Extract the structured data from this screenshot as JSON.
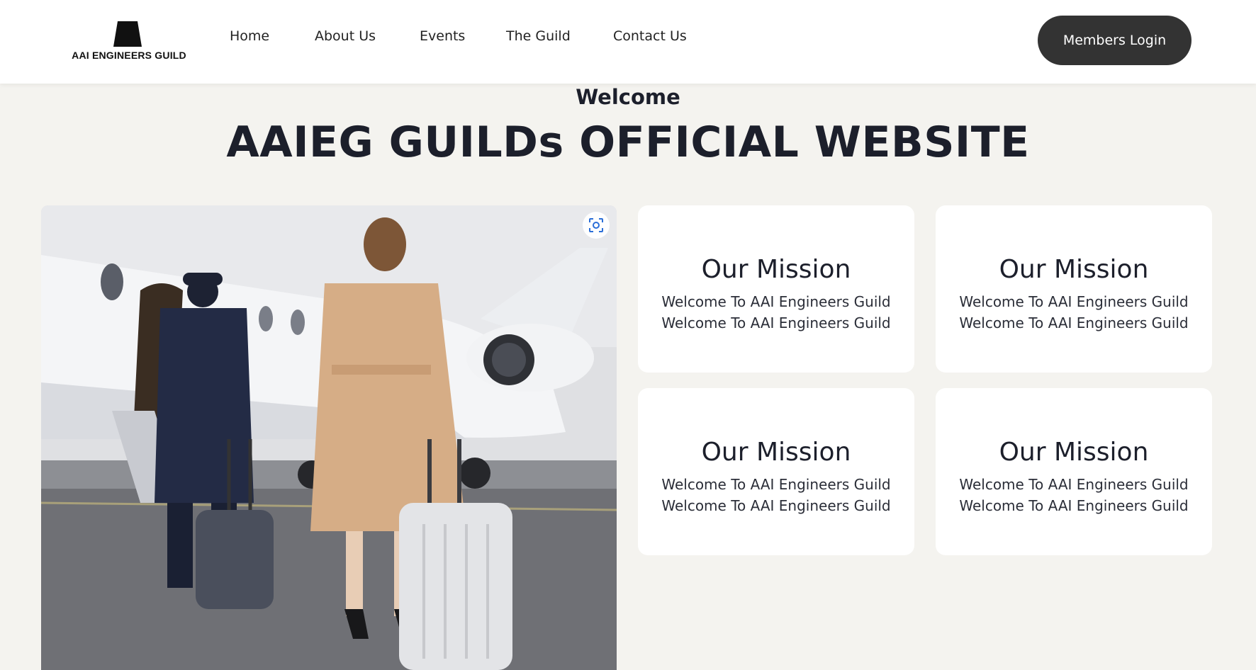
{
  "header": {
    "logo_text": "AAI ENGINEERS GUILD",
    "nav": [
      "Home",
      "About Us",
      "Events",
      "The Guild",
      "Contact Us"
    ],
    "login_label": "Members Login"
  },
  "hero": {
    "welcome": "Welcome",
    "title": "AAIEG GUILDs OFFICIAL WEBSITE"
  },
  "cards": [
    {
      "title": "Our Mission",
      "line1": "Welcome To AAI Engineers Guild",
      "line2": "Welcome To AAI Engineers Guild"
    },
    {
      "title": "Our Mission",
      "line1": "Welcome To AAI Engineers Guild",
      "line2": "Welcome To AAI Engineers Guild"
    },
    {
      "title": "Our Mission",
      "line1": "Welcome To AAI Engineers Guild",
      "line2": "Welcome To AAI Engineers Guild"
    },
    {
      "title": "Our Mission",
      "line1": "Welcome To AAI Engineers Guild",
      "line2": "Welcome To AAI Engineers Guild"
    }
  ],
  "colors": {
    "page_bg": "#f4f3ef",
    "header_bg": "#ffffff",
    "login_bg": "#333333",
    "heading": "#1c1f2b",
    "card_bg": "#ffffff"
  },
  "icons": {
    "lens": "visual-search-icon"
  }
}
